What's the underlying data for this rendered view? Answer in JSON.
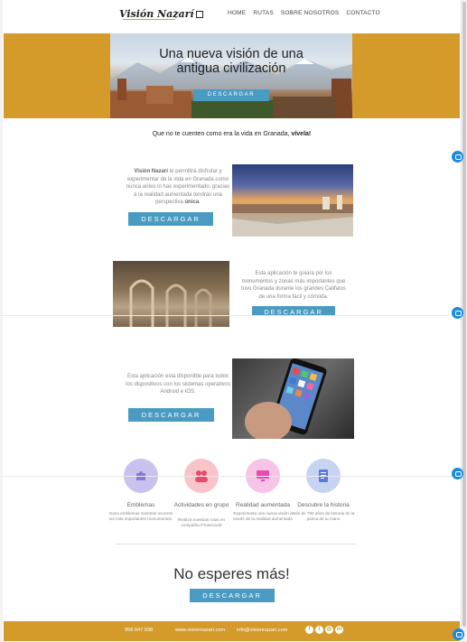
{
  "brand": {
    "logo_text": "Visión Nazarí"
  },
  "nav": {
    "items": [
      "HOME",
      "RUTAS",
      "SOBRE NOSOTROS",
      "CONTACTO"
    ]
  },
  "hero": {
    "title_line1": "Una nueva visión de una",
    "title_line2": "antigua civilización",
    "button": "DESCARGAR"
  },
  "tagline": {
    "text": "Que no te cuenten como era la vida en Granada, ",
    "strong": "vívela!"
  },
  "features": [
    {
      "lead": "Visión Nazarí",
      "text_a": " te permitirá disfrutar y experimentar de la vida en Granada como nunca antes lo has experimentado, gracias a la realidad aumentada tendrás una perspectiva ",
      "strong_end": "única",
      "text_b": ".",
      "button": "DESCARGAR"
    },
    {
      "text": "Esta aplicación te guiara por los monumentos y zonas más importantes que tuvo Granada durante los grandes Califatos de una forma fácil y cómoda.",
      "button": "DESCARGAR"
    },
    {
      "text": "Esta aplicación esta disponible para todos los dispositivos con los sistemas operativos Android e IOS.",
      "button": "DESCARGAR"
    }
  ],
  "icons": [
    {
      "icon": "puzzle-icon",
      "title": "Emblemas",
      "desc": "Gana emblemas mientras recorres los más importantes monumentos.",
      "color": "#c9c2ef"
    },
    {
      "icon": "group-icon",
      "title": "Actividades en grupo",
      "desc": "Realiza nuestras rutas en compañía #Yosecovid",
      "color": "#f9c4c9"
    },
    {
      "icon": "monitor-icon",
      "title": "Realidad aumentada",
      "desc": "Experimenta una nueva visión a través de la realidad aumentada",
      "color": "#f7c3e6"
    },
    {
      "icon": "document-icon",
      "title": "Descubre la historia",
      "desc": "Más de 780 años de historia en la palma de tu mano",
      "color": "#c6d3f2"
    }
  ],
  "cta": {
    "title": "No esperes más!",
    "button": "DESCARGAR"
  },
  "footer": {
    "phone": "958 847 938",
    "website": "www.visionnazari.com",
    "email": "info@visionnazari.com",
    "social": [
      "facebook-icon",
      "twitter-icon",
      "instagram-icon",
      "linkedin-icon"
    ]
  },
  "colors": {
    "accent": "#d49a2a",
    "button": "#4a9bc2",
    "chat": "#1a8ce0"
  }
}
